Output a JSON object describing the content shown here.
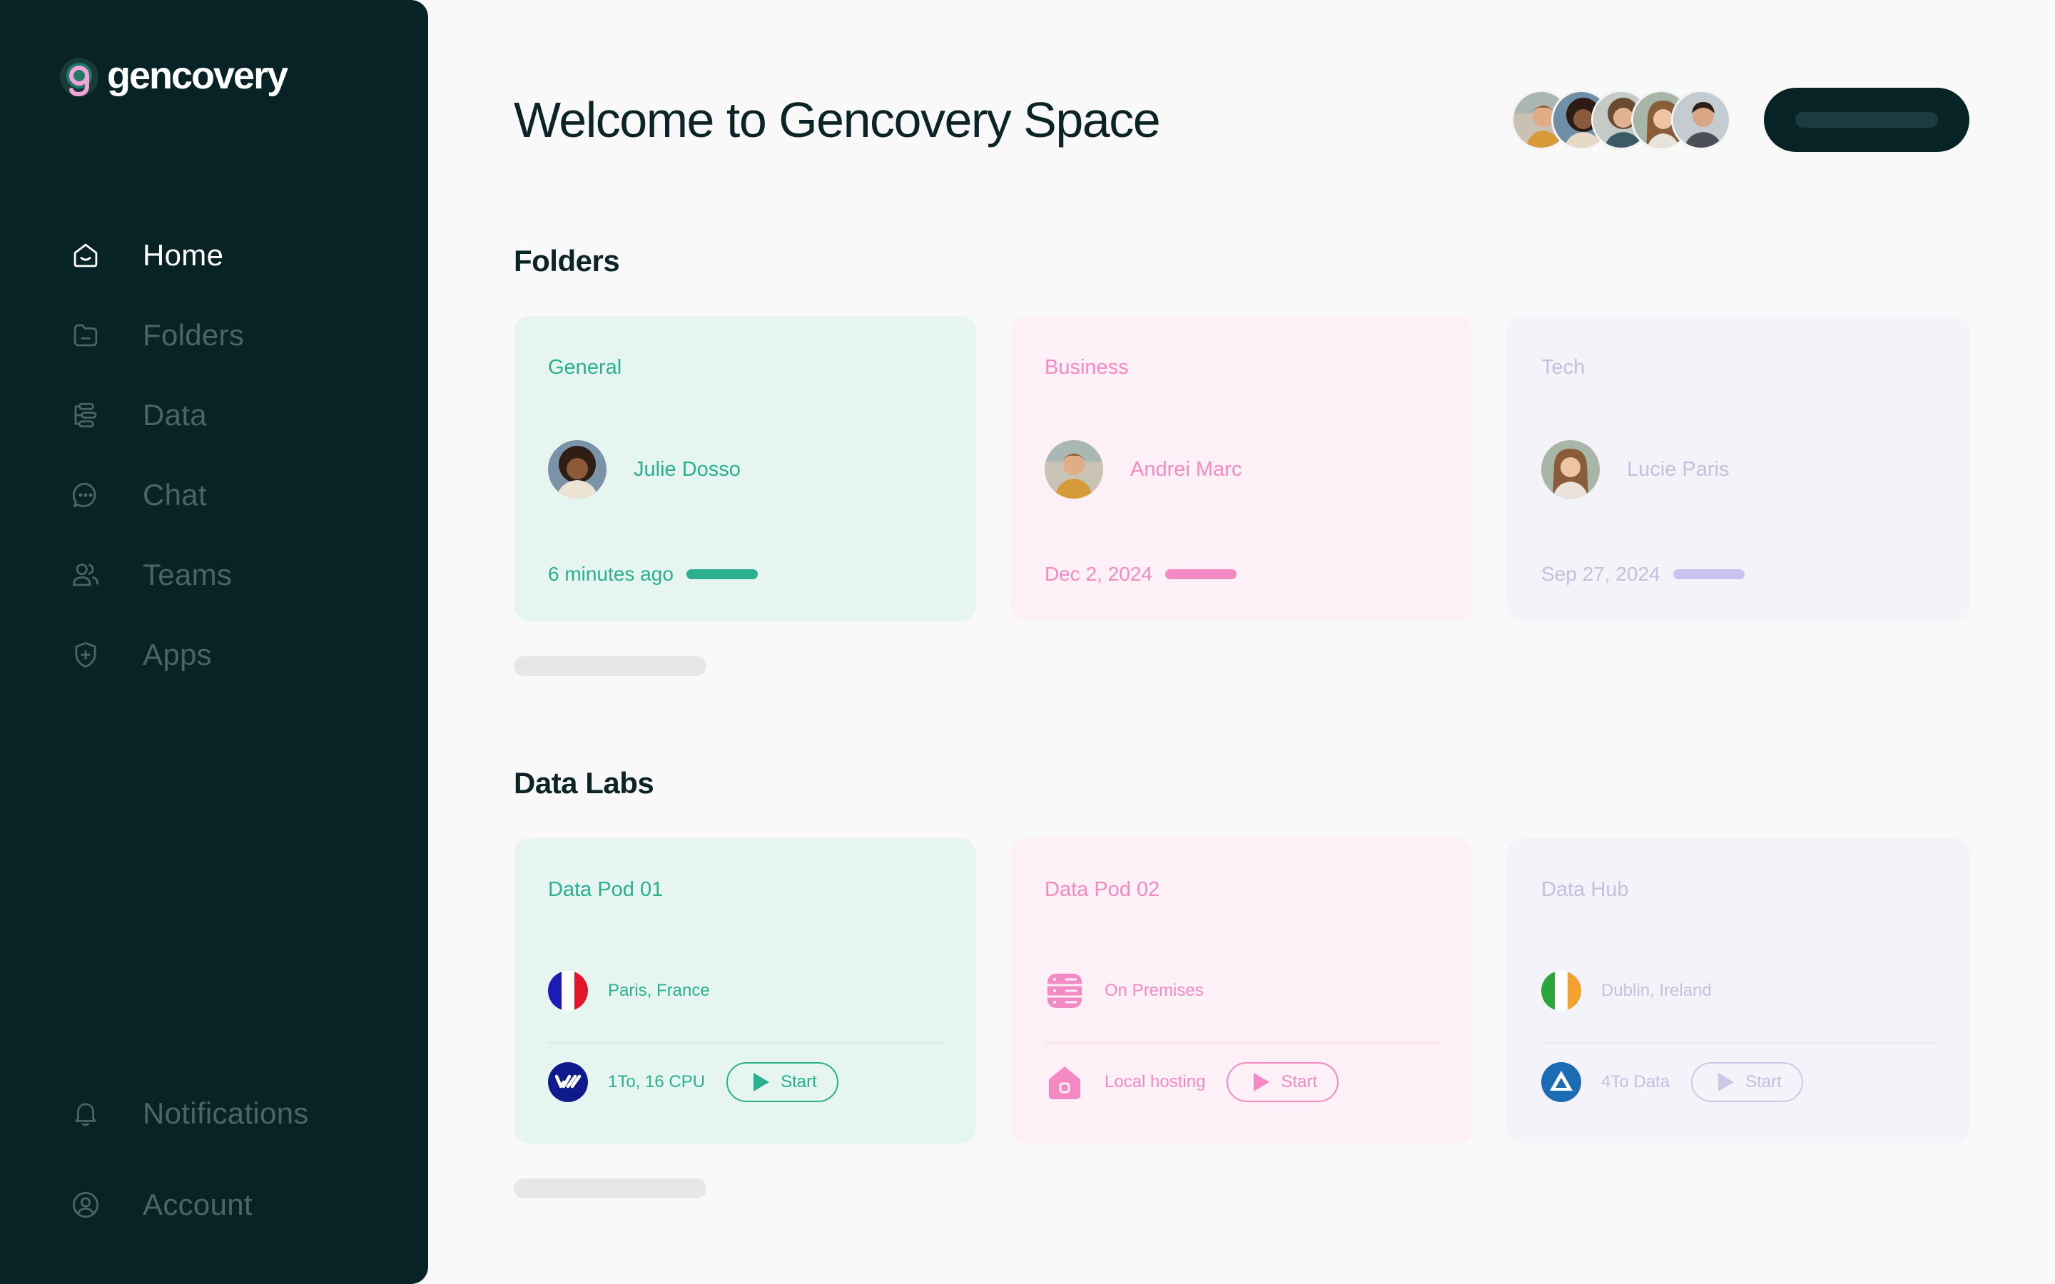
{
  "brand": {
    "name": "gencovery"
  },
  "sidebar": {
    "items": [
      {
        "label": "Home",
        "icon": "home-icon",
        "active": true
      },
      {
        "label": "Folders",
        "icon": "folder-icon"
      },
      {
        "label": "Data",
        "icon": "data-icon"
      },
      {
        "label": "Chat",
        "icon": "chat-icon"
      },
      {
        "label": "Teams",
        "icon": "users-icon"
      },
      {
        "label": "Apps",
        "icon": "shield-plus-icon"
      }
    ],
    "bottom": [
      {
        "label": "Notifications",
        "icon": "bell-icon"
      },
      {
        "label": "Account",
        "icon": "user-circle-icon"
      }
    ]
  },
  "header": {
    "title": "Welcome to Gencovery Space"
  },
  "folders": {
    "title": "Folders",
    "cards": [
      {
        "title": "General",
        "owner": "Julie Dosso",
        "date": "6 minutes ago",
        "color": "#2ab08f"
      },
      {
        "title": "Business",
        "owner": "Andrei Marc",
        "date": "Dec 2, 2024",
        "color": "#f48ac3"
      },
      {
        "title": "Tech",
        "owner": "Lucie Paris",
        "date": "Sep 27, 2024",
        "color": "#c9c1ee"
      }
    ]
  },
  "labs": {
    "title": "Data Labs",
    "cards": [
      {
        "title": "Data Pod 01",
        "location": "Paris, France",
        "location_icon": "france-flag-icon",
        "spec": "1To, 16 CPU",
        "spec_icon": "ovh-logo-icon",
        "start_label": "Start"
      },
      {
        "title": "Data Pod 02",
        "location": "On Premises",
        "location_icon": "server-icon",
        "spec": "Local hosting",
        "spec_icon": "house-icon",
        "start_label": "Start"
      },
      {
        "title": "Data Hub",
        "location": "Dublin, Ireland",
        "location_icon": "ireland-flag-icon",
        "spec": "4To Data",
        "spec_icon": "azure-logo-icon",
        "start_label": "Start"
      }
    ]
  }
}
